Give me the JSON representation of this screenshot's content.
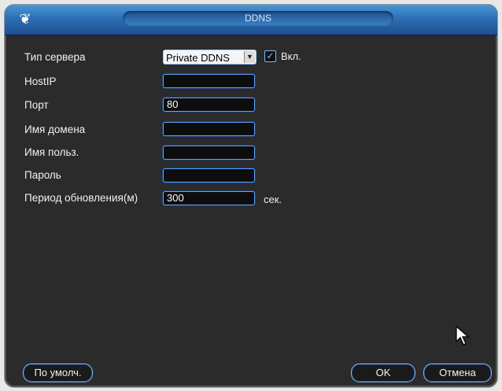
{
  "window": {
    "title": "DDNS"
  },
  "form": {
    "server_type": {
      "label": "Тип сервера",
      "value": "Private DDNS",
      "enabled_label": "Вкл.",
      "enabled": true
    },
    "host_ip": {
      "label": "HostIP",
      "value": ""
    },
    "port": {
      "label": "Порт",
      "value": "80"
    },
    "domain": {
      "label": "Имя домена",
      "value": ""
    },
    "username": {
      "label": "Имя польз.",
      "value": ""
    },
    "password": {
      "label": "Пароль",
      "value": ""
    },
    "update_period": {
      "label": "Период обновления(м)",
      "value": "300",
      "unit": "сек."
    }
  },
  "buttons": {
    "default": "По умолч.",
    "ok": "OK",
    "cancel": "Отмена"
  },
  "icons": {
    "logo": "app-logo-icon",
    "cursor": "mouse-pointer-icon",
    "dropdown": "chevron-down-icon"
  },
  "colors": {
    "accent": "#5ea3ff",
    "titlebar": "#2d6fb5",
    "background": "#2b2b2b"
  }
}
